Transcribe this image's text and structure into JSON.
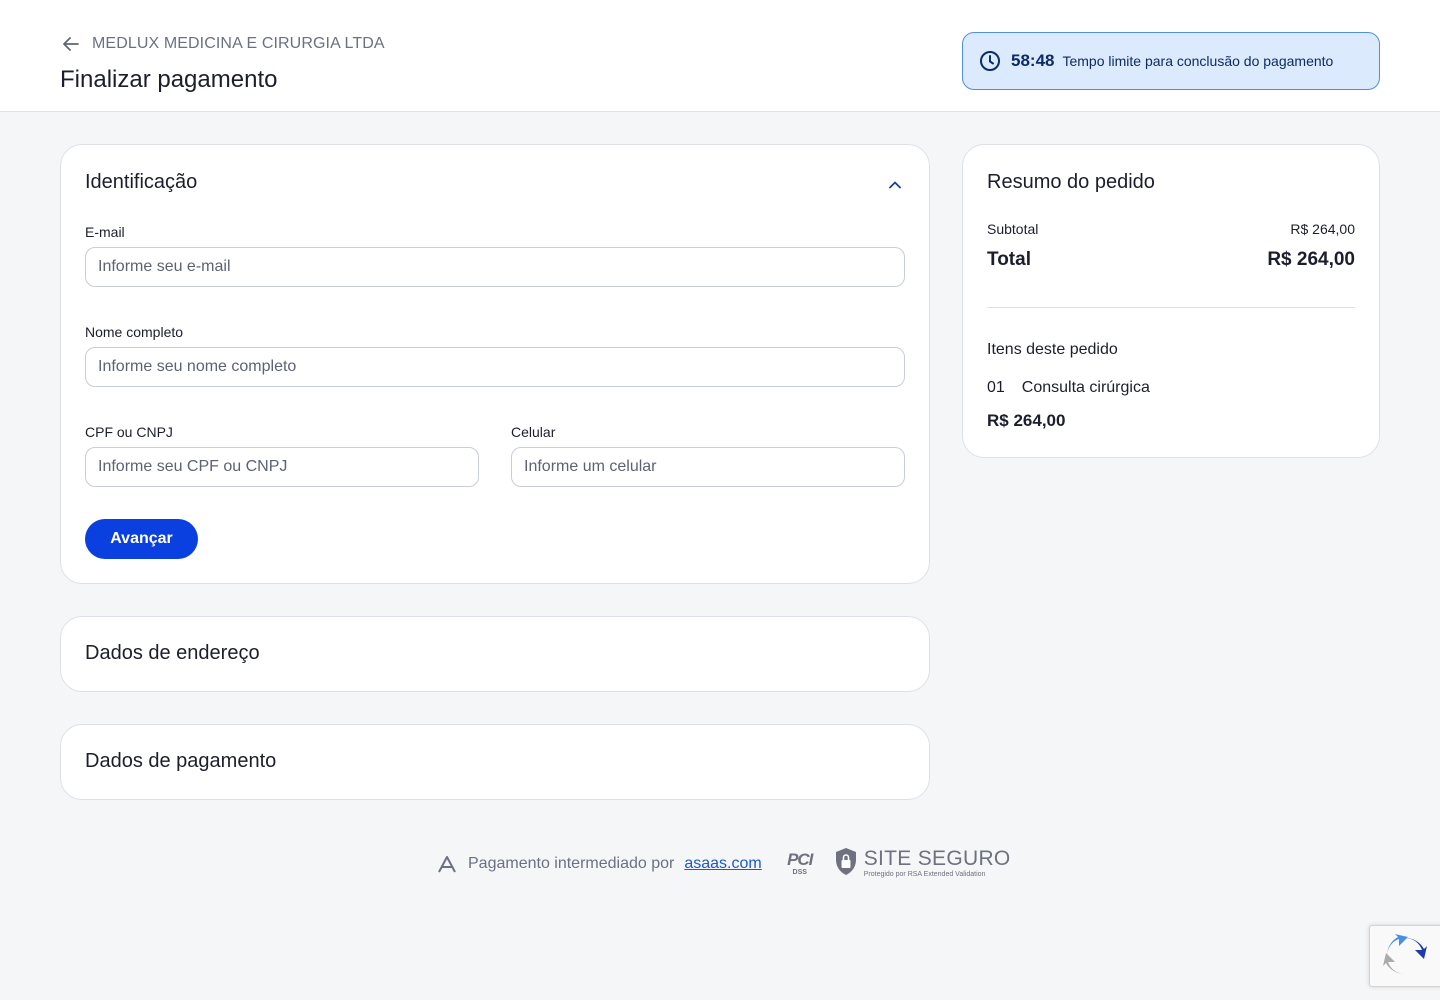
{
  "header": {
    "merchant_name": "MEDLUX MEDICINA E CIRURGIA LTDA",
    "page_title": "Finalizar pagamento",
    "timer_value": "58:48",
    "timer_label": "Tempo limite para conclusão do pagamento"
  },
  "identification": {
    "title": "Identificação",
    "email_label": "E-mail",
    "email_placeholder": "Informe seu e-mail",
    "name_label": "Nome completo",
    "name_placeholder": "Informe seu nome completo",
    "doc_label": "CPF ou CNPJ",
    "doc_placeholder": "Informe seu CPF ou CNPJ",
    "phone_label": "Celular",
    "phone_placeholder": "Informe um celular",
    "next_button": "Avançar"
  },
  "sections": {
    "address_title": "Dados de endereço",
    "payment_title": "Dados de pagamento"
  },
  "summary": {
    "title": "Resumo do pedido",
    "subtotal_label": "Subtotal",
    "subtotal_value": "R$ 264,00",
    "total_label": "Total",
    "total_value": "R$ 264,00",
    "items_title": "Itens deste pedido",
    "items": [
      {
        "qty": "01",
        "name": "Consulta cirúrgica",
        "price": "R$ 264,00"
      }
    ]
  },
  "footer": {
    "text": "Pagamento intermediado por",
    "link": "asaas.com",
    "pci_main": "PCI",
    "pci_sub": "DSS",
    "secure_title": "SITE SEGURO",
    "secure_subtitle": "Protegido por RSA Extended Validation"
  },
  "colors": {
    "primary": "#0a3fe0",
    "timer_bg": "#dbeafc",
    "timer_border": "#4f8fe0",
    "page_bg": "#f5f6f8"
  },
  "icons": [
    "arrow-left-icon",
    "clock-icon",
    "chevron-up-icon",
    "asaas-logo-icon",
    "shield-lock-icon",
    "recaptcha-icon"
  ]
}
